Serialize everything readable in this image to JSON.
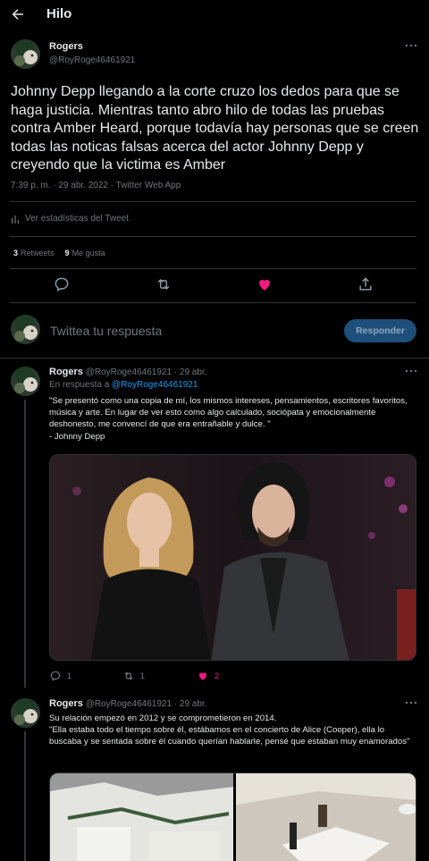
{
  "topbar": {
    "title": "Hilo"
  },
  "main_tweet": {
    "name": "Rogers",
    "handle": "@RoyRoge46461921",
    "text": "Johnny Depp llegando a la corte cruzo los dedos para que se haga justicia. Mientras tanto abro hilo de todas las pruebas contra Amber Heard, porque todavía hay personas que se creen todas las noticas falsas acerca del actor Johnny Depp y creyendo que la victima es Amber",
    "meta": "7:39 p. m. · 29 abr. 2022 · Twitter Web App",
    "stats_link": "Ver estadísticas del Tweet",
    "retweets_count": "3",
    "retweets_label": "Retweets",
    "likes_count": "9",
    "likes_label": "Me gusta"
  },
  "reply_box": {
    "placeholder": "Twittea tu respuesta",
    "button": "Responder"
  },
  "replies": [
    {
      "name": "Rogers",
      "handle_date": "@RoyRoge46461921 · 29 abr.",
      "in_reply_prefix": "En respuesta a",
      "in_reply_handle": "@RoyRoge46461921",
      "text": "\"Se presentó como una copia de mí, los mismos intereses, pensamientos, escritores favoritos, música y arte. En lugar de ver esto como algo calculado, sociópata y emocionalmente deshonesto, me convencí de que era entrañable y  dulce. \"\n - Johnny Depp",
      "replies_count": "1",
      "retweets_count": "1",
      "likes_count": "2"
    },
    {
      "name": "Rogers",
      "handle_date": "@RoyRoge46461921 · 29 abr.",
      "text": "Su relación empezó en 2012 y se comprometieron en 2014.\n\"Ella estaba todo el tiempo sobre él, estábamos en el concierto de Alice (Cooper), ella lo buscaba y se sentada sobre él cuando querían hablarle, pensé que estaban muy enamorados\""
    }
  ],
  "colors": {
    "background": "#000000",
    "text": "#e7e9ea",
    "muted": "#71767b",
    "accent": "#1d9bf0",
    "like": "#f91880",
    "divider": "#2f3336"
  },
  "icons": [
    "back-arrow-icon",
    "more-dots-icon",
    "stats-icon",
    "reply-icon",
    "retweet-icon",
    "heart-icon",
    "share-icon"
  ]
}
